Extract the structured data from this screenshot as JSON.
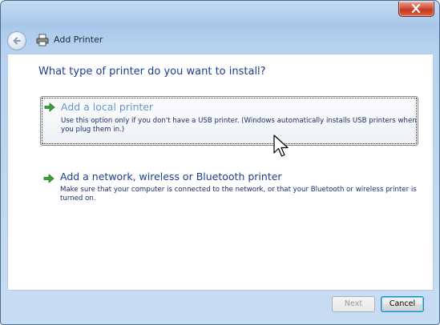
{
  "window": {
    "title": "Add Printer"
  },
  "page": {
    "heading": "What type of printer do you want to install?"
  },
  "options": [
    {
      "title": "Add a local printer",
      "description": "Use this option only if you don't have a USB printer. (Windows automatically installs USB printers when you plug them in.)"
    },
    {
      "title": "Add a network, wireless or Bluetooth printer",
      "description": "Make sure that your computer is connected to the network, or that your Bluetooth or wireless printer is turned on."
    }
  ],
  "buttons": {
    "next": "Next",
    "cancel": "Cancel"
  },
  "icons": {
    "back": "back-arrow-icon",
    "printer": "printer-icon",
    "option_arrow": "green-arrow-icon",
    "close": "close-icon",
    "cursor": "mouse-cursor-icon"
  },
  "colors": {
    "frame": "#b7d2ef",
    "heading": "#1d3e8f",
    "close_button": "#c7381f",
    "option_arrow": "#3aa33a"
  }
}
